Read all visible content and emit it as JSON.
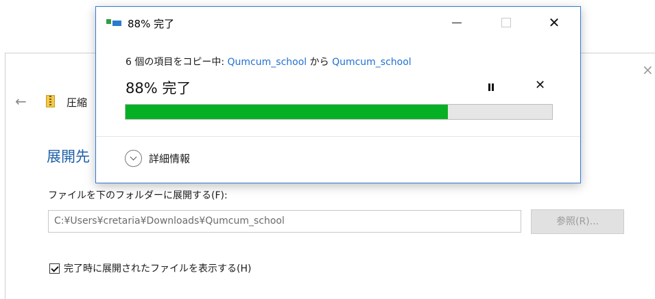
{
  "colors": {
    "accent": "#2e7bd6",
    "progress_fill": "#06b025",
    "progress_track": "#e6e6e6",
    "link": "#1f6fd1",
    "heading_blue": "#1f5fa8"
  },
  "background_dialog": {
    "close_glyph": "×",
    "back_glyph": "←",
    "breadcrumb": "圧縮",
    "heading": "展開先",
    "extract_label": "ファイルを下のフォルダーに展開する(F):",
    "path_value": "C:¥Users¥cretaria¥Downloads¥Qumcum_school",
    "browse_label": "参照(R)...",
    "show_files_label": "完了時に展開されたファイルを表示する(H)",
    "show_files_checked": true
  },
  "copy_dialog": {
    "title": "88% 完了",
    "desc_prefix": "6 個の項目をコピー中: ",
    "source": "Qumcum_school",
    "desc_mid": " から ",
    "destination": "Qumcum_school",
    "progress_text": "88% 完了",
    "progress_fraction": 0.755,
    "close_glyph": "✕",
    "stop_glyph": "✕",
    "details_label": "詳細情報",
    "icons": [
      "copy-transfer-icon",
      "minimize-icon",
      "maximize-icon",
      "close-icon",
      "pause-icon",
      "stop-icon",
      "chevron-down-icon"
    ]
  }
}
